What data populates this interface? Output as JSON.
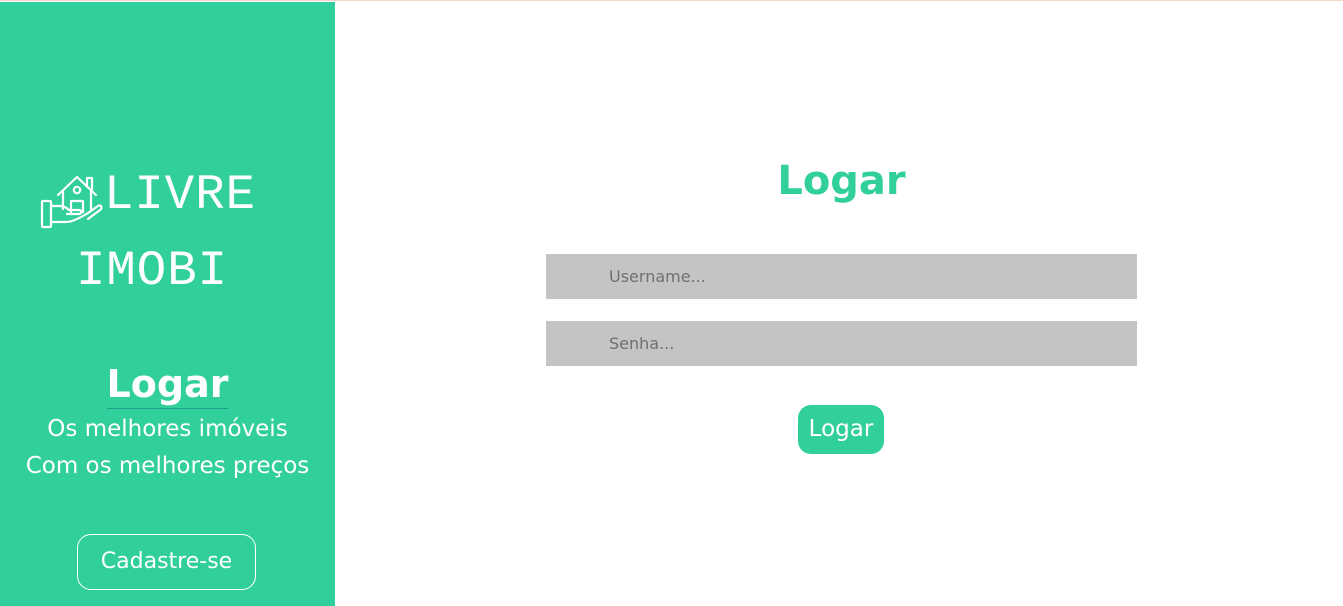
{
  "brand": {
    "line1": "LIVRE",
    "line2": "IMOBI",
    "icon": "house-in-hand-icon"
  },
  "sidebar": {
    "title": "Logar",
    "tagline_1": "Os melhores imóveis",
    "tagline_2": "Com os melhores preços",
    "signup_label": "Cadastre-se"
  },
  "form": {
    "title": "Logar",
    "username_placeholder": "Username...",
    "username_value": "",
    "password_placeholder": "Senha...",
    "password_value": "",
    "submit_label": "Logar"
  },
  "colors": {
    "accent": "#31cf9b",
    "input_bg": "#c4c4c4",
    "text_on_accent": "#ffffff"
  }
}
